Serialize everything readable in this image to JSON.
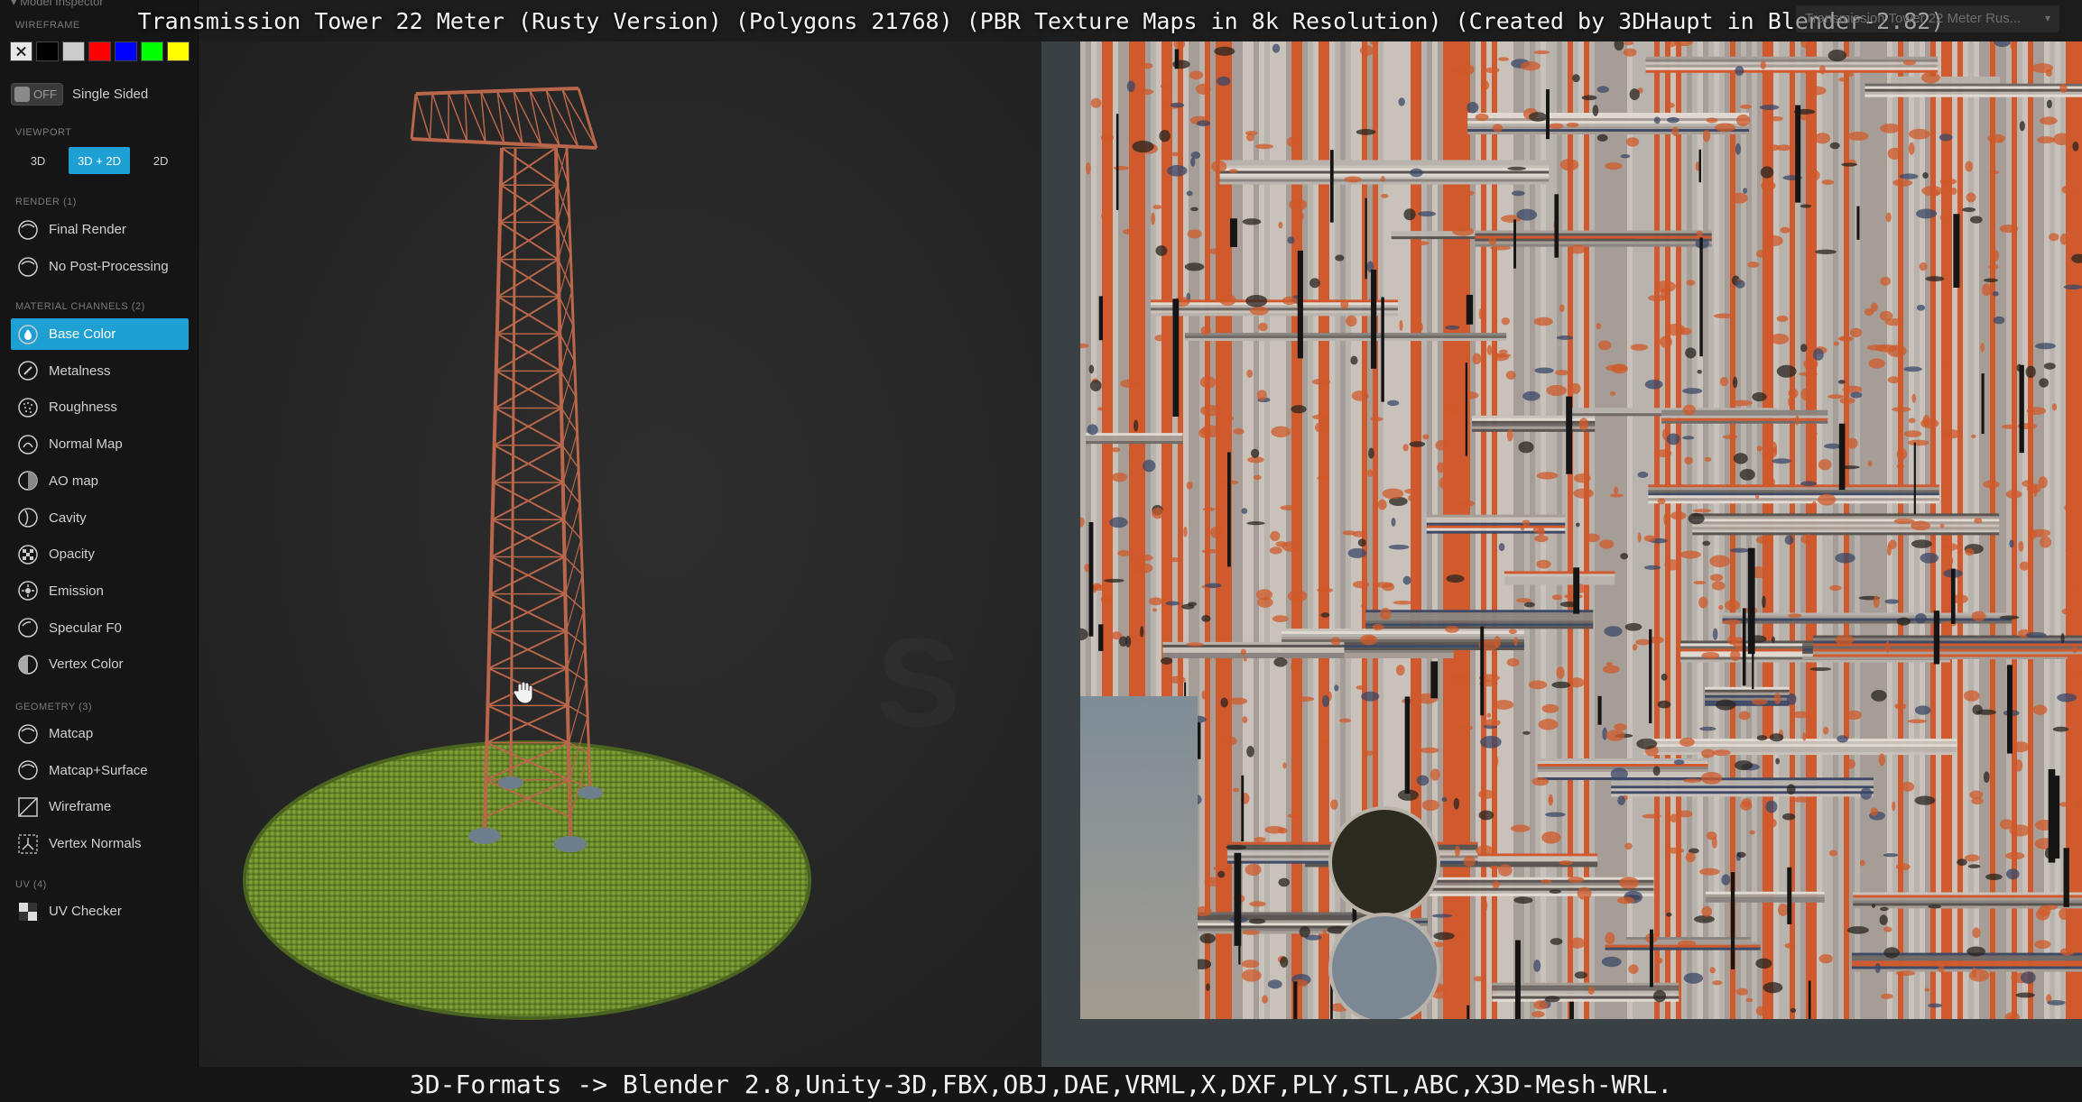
{
  "app": {
    "window_title": "Model Inspector",
    "title": "Transmission Tower 22 Meter (Rusty Version) (Polygons 21768) (PBR Texture Maps in 8k Resolution) (Created by 3DHaupt in Blender-2.82)",
    "model_select_value": "Transmission Tower 22 Meter Rus...",
    "footer": "3D-Formats -> Blender 2.8,Unity-3D,FBX,OBJ,DAE,VRML,X,DXF,PLY,STL,ABC,X3D-Mesh-WRL."
  },
  "sidebar": {
    "wireframe": {
      "title": "WIREFRAME",
      "swatch_colors": [
        "#000000",
        "#cccccc",
        "#ff0000",
        "#0000ff",
        "#00ff00",
        "#ffff00"
      ]
    },
    "single_sided": {
      "toggle_label": "OFF",
      "label": "Single Sided"
    },
    "viewport": {
      "title": "VIEWPORT",
      "options": [
        "3D",
        "3D + 2D",
        "2D"
      ],
      "selected": "3D + 2D"
    },
    "render": {
      "title": "RENDER (1)",
      "items": [
        {
          "label": "Final Render",
          "icon": "sphere-icon"
        },
        {
          "label": "No Post-Processing",
          "icon": "sphere-icon"
        }
      ]
    },
    "material_channels": {
      "title": "MATERIAL CHANNELS (2)",
      "selected": "Base Color",
      "items": [
        {
          "label": "Base Color",
          "icon": "droplet-sphere-icon"
        },
        {
          "label": "Metalness",
          "icon": "metal-sphere-icon"
        },
        {
          "label": "Roughness",
          "icon": "rough-sphere-icon"
        },
        {
          "label": "Normal Map",
          "icon": "normal-sphere-icon"
        },
        {
          "label": "AO map",
          "icon": "ao-sphere-icon"
        },
        {
          "label": "Cavity",
          "icon": "cavity-sphere-icon"
        },
        {
          "label": "Opacity",
          "icon": "checker-sphere-icon"
        },
        {
          "label": "Emission",
          "icon": "emission-sphere-icon"
        },
        {
          "label": "Specular F0",
          "icon": "specular-sphere-icon"
        },
        {
          "label": "Vertex Color",
          "icon": "vertex-color-sphere-icon"
        }
      ]
    },
    "geometry": {
      "title": "GEOMETRY (3)",
      "items": [
        {
          "label": "Matcap",
          "icon": "sphere-icon"
        },
        {
          "label": "Matcap+Surface",
          "icon": "sphere-icon"
        },
        {
          "label": "Wireframe",
          "icon": "wireframe-icon"
        },
        {
          "label": "Vertex Normals",
          "icon": "normals-icon"
        }
      ]
    },
    "uv": {
      "title": "UV (4)",
      "items": [
        {
          "label": "UV Checker",
          "icon": "checker-icon"
        }
      ]
    }
  },
  "colors": {
    "accent": "#1ea0d4",
    "rust": "#c0552d",
    "grass": "#7a9a35"
  }
}
